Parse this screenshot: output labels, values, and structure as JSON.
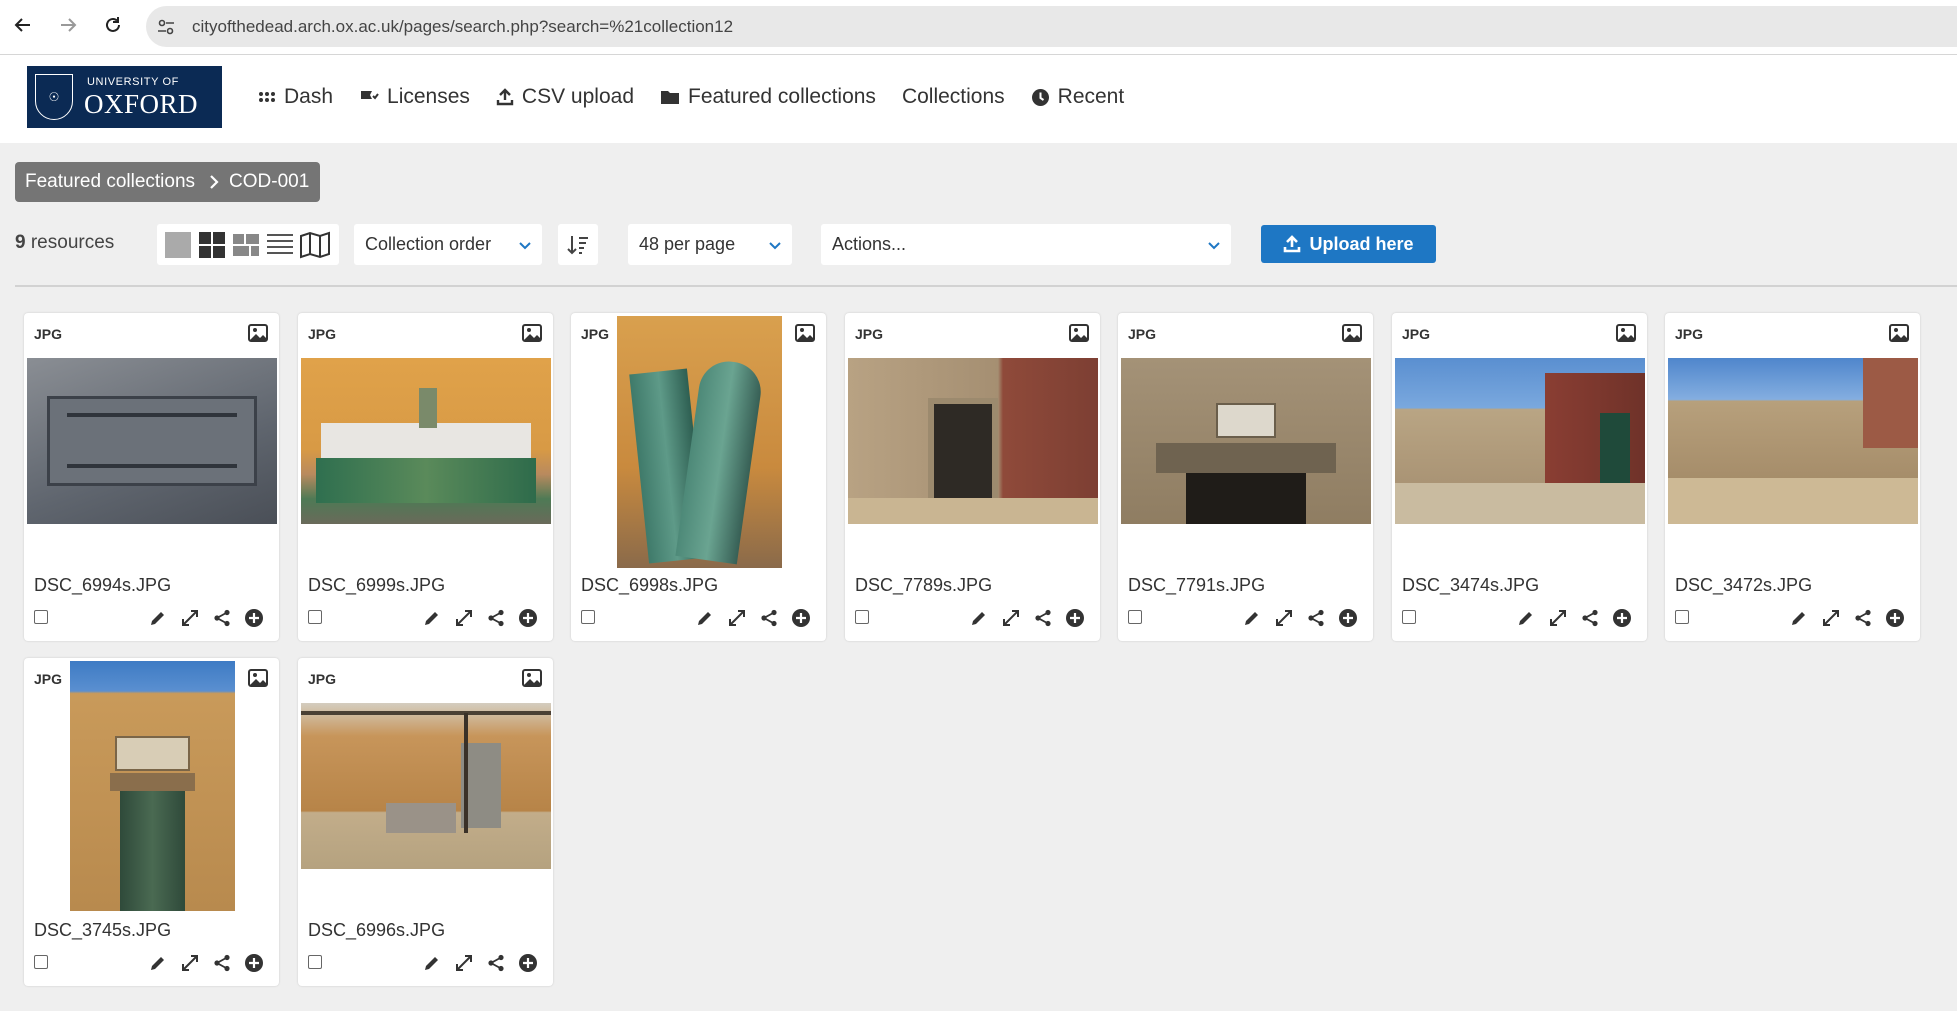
{
  "browser": {
    "url": "cityofthedead.arch.ox.ac.uk/pages/search.php?search=%21collection12"
  },
  "logo": {
    "line1": "UNIVERSITY OF",
    "line2": "OXFORD"
  },
  "nav": {
    "dash": "Dash",
    "licenses": "Licenses",
    "csv_upload": "CSV upload",
    "featured_collections": "Featured collections",
    "collections": "Collections",
    "recent": "Recent"
  },
  "breadcrumb": {
    "parent": "Featured collections",
    "current": "COD-001"
  },
  "toolbar": {
    "count": "9",
    "count_label": "resources",
    "sort_order": "Collection order",
    "per_page": "48 per page",
    "actions": "Actions...",
    "upload_label": "Upload here"
  },
  "resources": [
    {
      "type": "JPG",
      "name": "DSC_6994s.JPG"
    },
    {
      "type": "JPG",
      "name": "DSC_6999s.JPG"
    },
    {
      "type": "JPG",
      "name": "DSC_6998s.JPG"
    },
    {
      "type": "JPG",
      "name": "DSC_7789s.JPG"
    },
    {
      "type": "JPG",
      "name": "DSC_7791s.JPG"
    },
    {
      "type": "JPG",
      "name": "DSC_3474s.JPG"
    },
    {
      "type": "JPG",
      "name": "DSC_3472s.JPG"
    },
    {
      "type": "JPG",
      "name": "DSC_3745s.JPG"
    },
    {
      "type": "JPG",
      "name": "DSC_6996s.JPG"
    }
  ],
  "colors": {
    "accent": "#1e77c4",
    "breadcrumb_bg": "#757575",
    "logo_bg": "#0b2a54"
  }
}
